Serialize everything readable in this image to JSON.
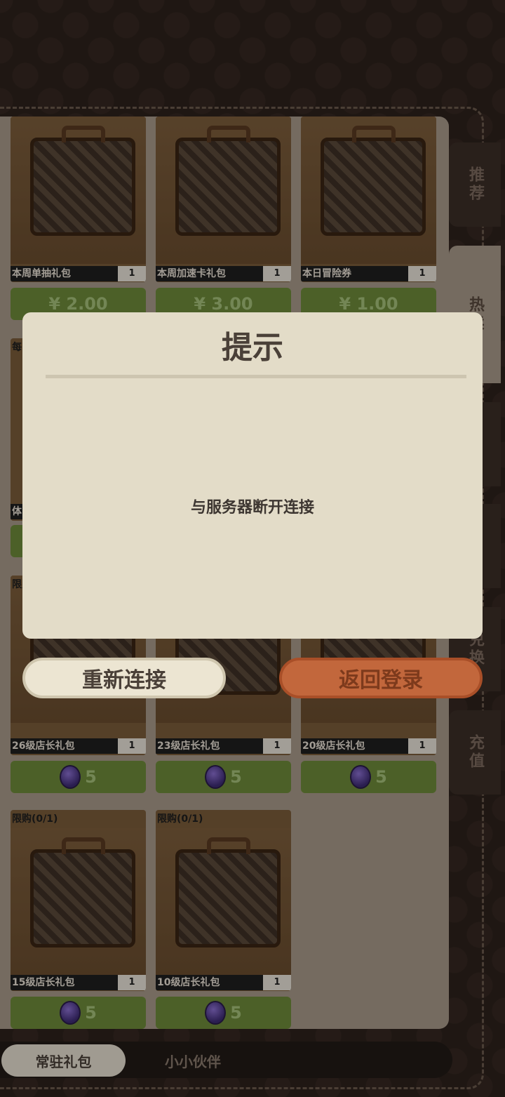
{
  "side_tabs": [
    {
      "label": "推荐",
      "active": false
    },
    {
      "label": "热卖",
      "active": true
    },
    {
      "label": "",
      "active": false
    },
    {
      "label": "",
      "active": false
    },
    {
      "label": "兑换",
      "active": false
    },
    {
      "label": "充值",
      "active": false
    }
  ],
  "cards": [
    {
      "name": "本周单抽礼包",
      "qty": "1",
      "price": "¥ 2.00",
      "currency": "yuan",
      "limit": ""
    },
    {
      "name": "本周加速卡礼包",
      "qty": "1",
      "price": "¥ 3.00",
      "currency": "yuan",
      "limit": ""
    },
    {
      "name": "本日冒险券",
      "qty": "1",
      "price": "¥ 1.00",
      "currency": "yuan",
      "limit": ""
    },
    {
      "name": "26级店长礼包",
      "qty": "1",
      "price": "5",
      "currency": "gem",
      "limit": "限购"
    },
    {
      "name": "23级店长礼包",
      "qty": "1",
      "price": "5",
      "currency": "gem",
      "limit": ""
    },
    {
      "name": "20级店长礼包",
      "qty": "1",
      "price": "5",
      "currency": "gem",
      "limit": ""
    },
    {
      "name": "15级店长礼包",
      "qty": "1",
      "price": "5",
      "currency": "gem",
      "limit": "限购(0/1)"
    },
    {
      "name": "10级店长礼包",
      "qty": "1",
      "price": "5",
      "currency": "gem",
      "limit": "限购(0/1)"
    }
  ],
  "peek_labels": {
    "row2_left_top": "每",
    "row2_left_bottom": "体"
  },
  "bottom_tabs": [
    {
      "label": "常驻礼包",
      "active": true
    },
    {
      "label": "小小伙伴",
      "active": false
    }
  ],
  "dialog": {
    "title": "提示",
    "message": "与服务器断开连接",
    "reconnect_label": "重新连接",
    "return_label": "返回登录"
  }
}
